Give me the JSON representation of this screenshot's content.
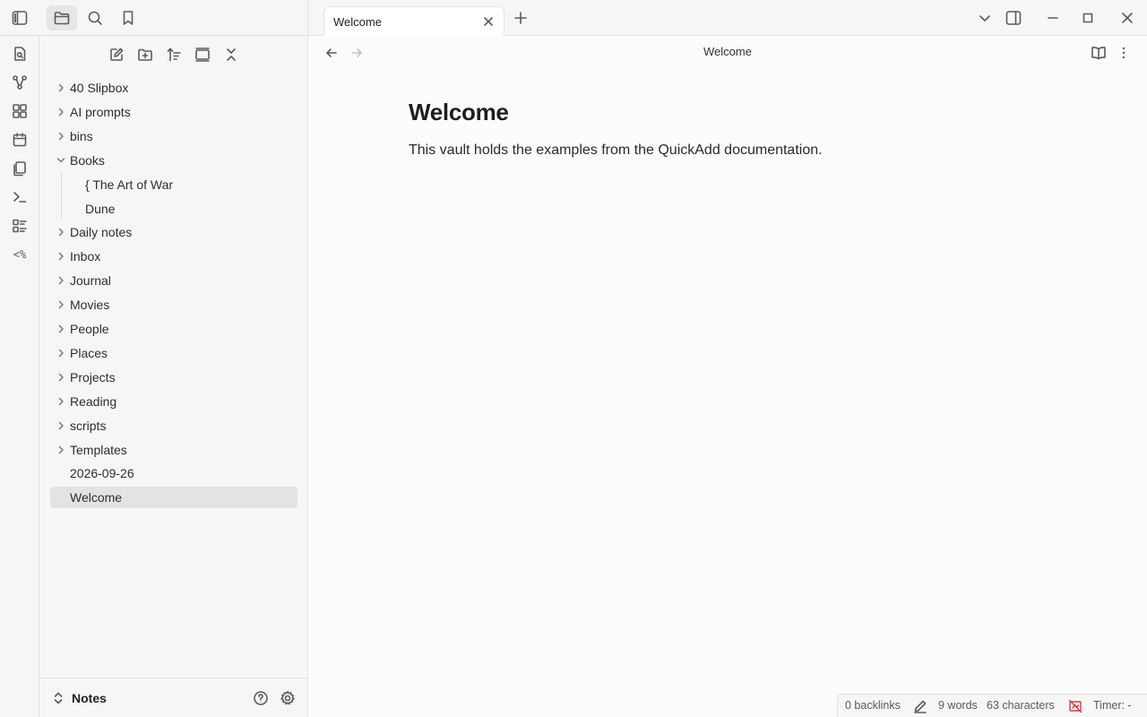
{
  "top_left": {
    "buttons": [
      "sidebar-toggle-icon",
      "folder-icon",
      "search-icon",
      "bookmark-icon"
    ]
  },
  "ribbon": {
    "items": [
      "open-quick-switcher-icon",
      "graph-view-icon",
      "canvas-icon",
      "daily-note-icon",
      "templates-icon",
      "command-palette-icon",
      "outline-icon"
    ],
    "templater_label": "<%"
  },
  "sidebar": {
    "actions": [
      "new-note-icon",
      "new-folder-icon",
      "sort-icon",
      "auto-reveal-icon",
      "collapse-all-icon"
    ],
    "tree": [
      {
        "label": "40 Slipbox",
        "type": "folder",
        "expanded": false
      },
      {
        "label": "AI prompts",
        "type": "folder",
        "expanded": false
      },
      {
        "label": "bins",
        "type": "folder",
        "expanded": false
      },
      {
        "label": "Books",
        "type": "folder",
        "expanded": true
      },
      {
        "label": "{ The Art of War",
        "type": "file",
        "child": true
      },
      {
        "label": "Dune",
        "type": "file",
        "child": true
      },
      {
        "label": "Daily notes",
        "type": "folder",
        "expanded": false
      },
      {
        "label": "Inbox",
        "type": "folder",
        "expanded": false
      },
      {
        "label": "Journal",
        "type": "folder",
        "expanded": false
      },
      {
        "label": "Movies",
        "type": "folder",
        "expanded": false
      },
      {
        "label": "People",
        "type": "folder",
        "expanded": false
      },
      {
        "label": "Places",
        "type": "folder",
        "expanded": false
      },
      {
        "label": "Projects",
        "type": "folder",
        "expanded": false
      },
      {
        "label": "Reading",
        "type": "folder",
        "expanded": false
      },
      {
        "label": "scripts",
        "type": "folder",
        "expanded": false
      },
      {
        "label": "Templates",
        "type": "folder",
        "expanded": false
      },
      {
        "label": "2026-09-26",
        "type": "file"
      },
      {
        "label": "Welcome",
        "type": "file",
        "selected": true
      }
    ],
    "vault_name": "Notes"
  },
  "tabs": [
    {
      "title": "Welcome",
      "active": true
    }
  ],
  "view": {
    "title": "Welcome"
  },
  "document": {
    "heading": "Welcome",
    "paragraph": "This vault holds the examples from the QuickAdd documentation."
  },
  "status": {
    "backlinks": "0 backlinks",
    "words": "9 words",
    "characters": "63 characters",
    "timer": "Timer: -"
  },
  "colors": {
    "selected_bg": "#e3e3e3",
    "sidebar_bg": "#f6f6f6",
    "content_bg": "#fcfcfd",
    "sync_error": "#d04040"
  }
}
